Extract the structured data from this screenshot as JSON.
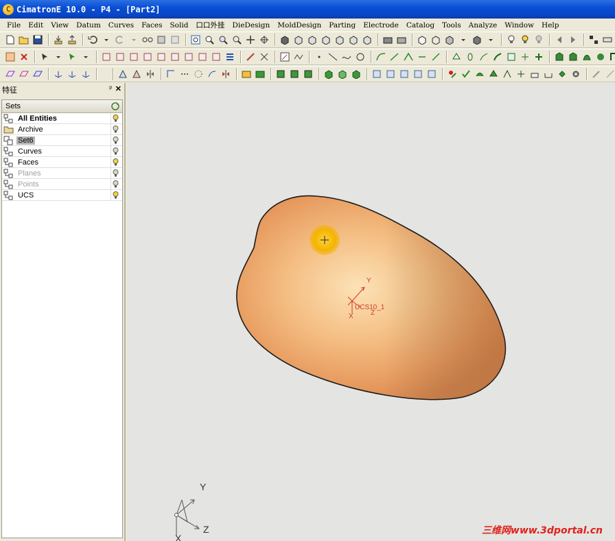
{
  "window": {
    "title": "CimatronE 10.0 - P4 - [Part2]"
  },
  "menu": [
    "File",
    "Edit",
    "View",
    "Datum",
    "Curves",
    "Faces",
    "Solid",
    "口口外挂",
    "DieDesign",
    "MoldDesign",
    "Parting",
    "Electrode",
    "Catalog",
    "Tools",
    "Analyze",
    "Window",
    "Help"
  ],
  "panel": {
    "title": "特征",
    "pin": "ᵖ",
    "close": "✕",
    "header": "Sets",
    "rows": [
      {
        "label": "All Entities",
        "style": "bold",
        "bulb": "on"
      },
      {
        "label": "Archive",
        "style": "normal",
        "bulb": "off"
      },
      {
        "label": "Set6",
        "style": "selected",
        "bulb": "off"
      },
      {
        "label": "Curves",
        "style": "normal",
        "bulb": "off"
      },
      {
        "label": "Faces",
        "style": "normal",
        "bulb": "on"
      },
      {
        "label": "Planes",
        "style": "dim",
        "bulb": "off"
      },
      {
        "label": "Points",
        "style": "dim",
        "bulb": "off"
      },
      {
        "label": "UCS",
        "style": "normal",
        "bulb": "on"
      }
    ]
  },
  "viewport": {
    "ucs_name": "UCS10_1",
    "ucs_axis_y": "Y",
    "ucs_axis_x": "X",
    "ucs_axis_z": "Z",
    "triad_y": "Y",
    "triad_z": "Z",
    "triad_x": "X",
    "watermark": "三维网www.3dportal.cn"
  },
  "colors": {
    "title_bar": "#0a4fd6",
    "surface": "#e9a06a",
    "highlight": "#f3b400",
    "ucs": "#d03a2a"
  }
}
